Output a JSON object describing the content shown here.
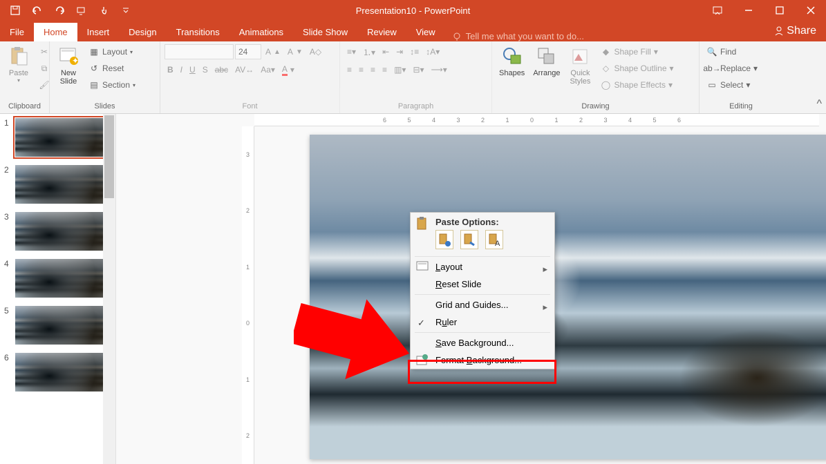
{
  "title": "Presentation10 - PowerPoint",
  "tabs": {
    "file": "File",
    "home": "Home",
    "insert": "Insert",
    "design": "Design",
    "transitions": "Transitions",
    "animations": "Animations",
    "slideshow": "Slide Show",
    "review": "Review",
    "view": "View"
  },
  "tellme": "Tell me what you want to do...",
  "share": "Share",
  "ribbon": {
    "clipboard": {
      "label": "Clipboard",
      "paste": "Paste"
    },
    "slides": {
      "label": "Slides",
      "newslide": "New\nSlide",
      "layout": "Layout",
      "reset": "Reset",
      "section": "Section"
    },
    "font": {
      "label": "Font",
      "size": "24",
      "name": ""
    },
    "paragraph": {
      "label": "Paragraph"
    },
    "drawing": {
      "label": "Drawing",
      "shapes": "Shapes",
      "arrange": "Arrange",
      "quick": "Quick\nStyles",
      "shapefill": "Shape Fill",
      "shapeoutline": "Shape Outline",
      "shapeeffects": "Shape Effects"
    },
    "editing": {
      "label": "Editing",
      "find": "Find",
      "replace": "Replace",
      "select": "Select"
    }
  },
  "thumbs": [
    "1",
    "2",
    "3",
    "4",
    "5",
    "6"
  ],
  "ruler_h": "6        5        4        3        2        1        0        1        2        3        4        5        6",
  "ruler_v": [
    "3",
    "2",
    "1",
    "0",
    "1",
    "2"
  ],
  "context_menu": {
    "paste_header": "Paste Options:",
    "layout": "Layout",
    "reset": "Reset Slide",
    "grid": "Grid and Guides...",
    "ruler": "Ruler",
    "savebg": "Save Background...",
    "formatbg": "Format Background..."
  }
}
